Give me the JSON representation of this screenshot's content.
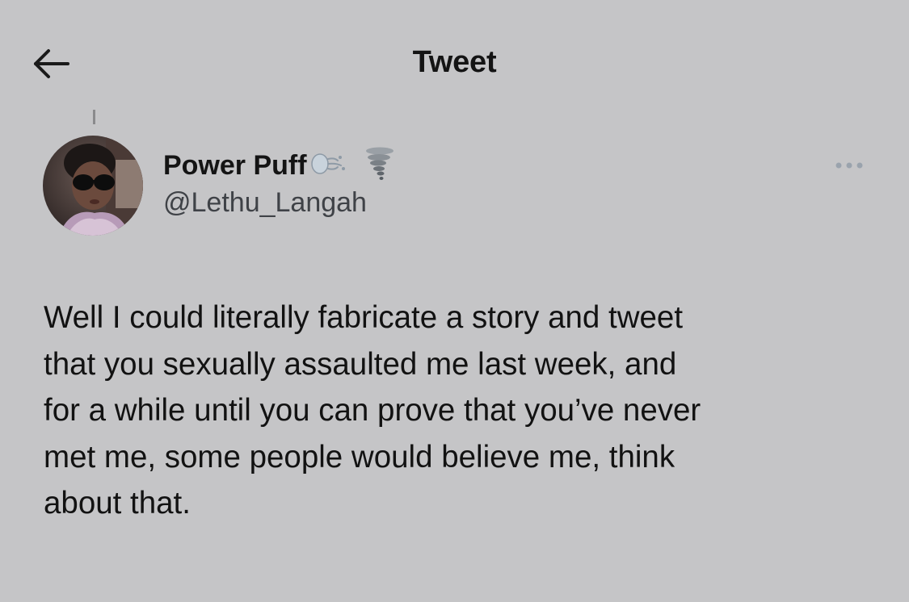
{
  "header": {
    "title": "Tweet",
    "back_icon": "arrow-left-icon"
  },
  "author": {
    "display_name": "Power Puff",
    "name_emojis": [
      "wind-face-icon",
      "tornado-icon"
    ],
    "handle": "@Lethu_Langah",
    "avatar": "user-avatar-photo"
  },
  "more_icon": "ellipsis-icon",
  "tweet": {
    "text": "Well I could literally fabricate a story and tweet\nthat you sexually assaulted me last week, and\nfor a while until you can prove that you’ve never\nmet me, some  people would believe me, think\nabout that."
  },
  "colors": {
    "background": "#c5c5c7",
    "text": "#141414",
    "secondary_text": "#3f4247",
    "muted_icon": "#9aa3ad"
  }
}
